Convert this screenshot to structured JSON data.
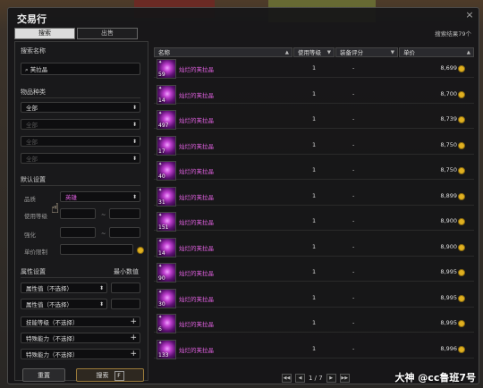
{
  "window": {
    "title": "交易行",
    "close_icon": "×",
    "search_result": "搜索结果79个"
  },
  "tabs": [
    {
      "label": "搜索"
    },
    {
      "label": "出售"
    }
  ],
  "left": {
    "search_name_label": "搜索名称",
    "search_value": "芙拉晶",
    "item_type_label": "物品种类",
    "type_select_1": "全部",
    "type_select_2": "全部",
    "type_select_3": "全部",
    "type_select_4": "全部",
    "default_label": "默认设置",
    "quality_label": "品质",
    "quality_value": "英雄",
    "use_level_label": "使用等级",
    "tilde": "~",
    "enhance_label": "强化",
    "unit_price_label": "单价限制",
    "attr_label": "属性设置",
    "min_value_label": "最小数值",
    "attr_select_1": "属性值（不选择）",
    "attr_select_2": "属性值（不选择）",
    "skill_level": "技能等级（不选择）",
    "special_1": "特殊能力（不选择）",
    "special_2": "特殊能力（不选择）",
    "reset_button": "重置",
    "search_button": "搜索",
    "search_key": "F"
  },
  "headers": {
    "name": "名称",
    "use_level": "使用等级",
    "score": "装备评分",
    "price": "单价"
  },
  "rows": [
    {
      "qty": "59",
      "name": "灿烂的芙拉晶",
      "level": "1",
      "score": "-",
      "price": "8,699"
    },
    {
      "qty": "14",
      "name": "灿烂的芙拉晶",
      "level": "1",
      "score": "-",
      "price": "8,700"
    },
    {
      "qty": "497",
      "name": "灿烂的芙拉晶",
      "level": "1",
      "score": "-",
      "price": "8,739"
    },
    {
      "qty": "17",
      "name": "灿烂的芙拉晶",
      "level": "1",
      "score": "-",
      "price": "8,750"
    },
    {
      "qty": "40",
      "name": "灿烂的芙拉晶",
      "level": "1",
      "score": "-",
      "price": "8,750"
    },
    {
      "qty": "31",
      "name": "灿烂的芙拉晶",
      "level": "1",
      "score": "-",
      "price": "8,899"
    },
    {
      "qty": "151",
      "name": "灿烂的芙拉晶",
      "level": "1",
      "score": "-",
      "price": "8,900"
    },
    {
      "qty": "14",
      "name": "灿烂的芙拉晶",
      "level": "1",
      "score": "-",
      "price": "8,900"
    },
    {
      "qty": "90",
      "name": "灿烂的芙拉晶",
      "level": "1",
      "score": "-",
      "price": "8,995"
    },
    {
      "qty": "30",
      "name": "灿烂的芙拉晶",
      "level": "1",
      "score": "-",
      "price": "8,995"
    },
    {
      "qty": "6",
      "name": "灿烂的芙拉晶",
      "level": "1",
      "score": "-",
      "price": "8,995"
    },
    {
      "qty": "133",
      "name": "灿烂的芙拉晶",
      "level": "1",
      "score": "-",
      "price": "8,996"
    }
  ],
  "pager": {
    "text": "1 / 7"
  },
  "watermark": "大神 @cc鲁班7号"
}
